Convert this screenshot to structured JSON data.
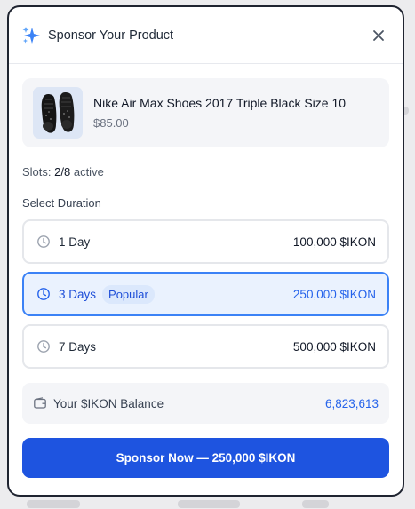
{
  "modal": {
    "title": "Sponsor Your Product",
    "icons": {
      "title": "sparkle-icon",
      "close": "close-icon"
    }
  },
  "product": {
    "name": "Nike Air Max Shoes 2017 Triple Black Size 10",
    "price": "$85.00",
    "image": "black-sneakers-image"
  },
  "slots": {
    "label": "Slots:",
    "value": "2/8",
    "suffix": "active"
  },
  "duration": {
    "label": "Select Duration",
    "options": [
      {
        "label": "1 Day",
        "price": "100,000 $IKON",
        "selected": false,
        "badge": ""
      },
      {
        "label": "3 Days",
        "price": "250,000 $IKON",
        "selected": true,
        "badge": "Popular"
      },
      {
        "label": "7 Days",
        "price": "500,000 $IKON",
        "selected": false,
        "badge": ""
      }
    ]
  },
  "balance": {
    "label": "Your $IKON Balance",
    "value": "6,823,613",
    "icon": "wallet-icon"
  },
  "cta": {
    "label": "Sponsor Now — 250,000 $IKON"
  },
  "colors": {
    "accent": "#1e54e0",
    "accent_text": "#2563eb",
    "selected_border": "#3b82f6",
    "selected_bg": "#eaf2fe",
    "sparkle": "#3b82f6"
  }
}
